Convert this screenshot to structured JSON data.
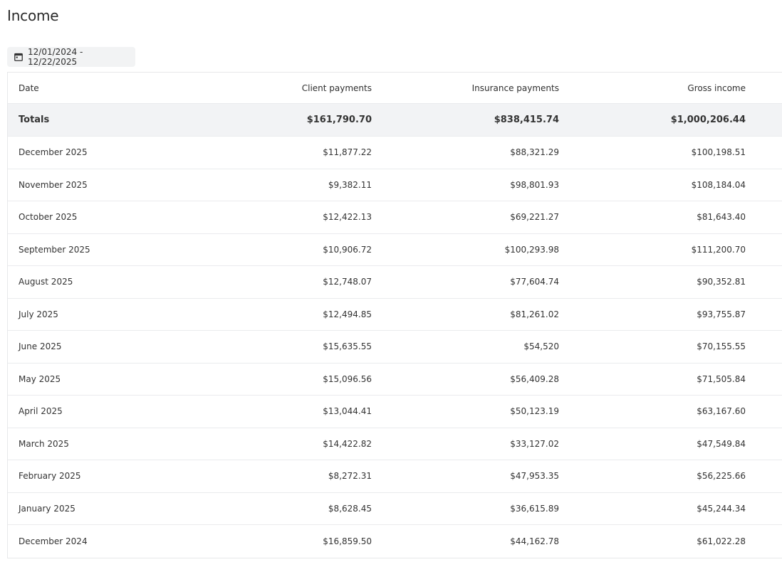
{
  "page": {
    "title": "Income"
  },
  "filter": {
    "date_range": "12/01/2024 - 12/22/2025",
    "icon": "calendar-icon"
  },
  "table": {
    "columns": {
      "date": "Date",
      "client": "Client payments",
      "insurance": "Insurance payments",
      "gross": "Gross income"
    },
    "totals": {
      "label": "Totals",
      "client": "$161,790.70",
      "insurance": "$838,415.74",
      "gross": "$1,000,206.44"
    },
    "rows": [
      {
        "date": "December 2025",
        "client": "$11,877.22",
        "insurance": "$88,321.29",
        "gross": "$100,198.51"
      },
      {
        "date": "November 2025",
        "client": "$9,382.11",
        "insurance": "$98,801.93",
        "gross": "$108,184.04"
      },
      {
        "date": "October 2025",
        "client": "$12,422.13",
        "insurance": "$69,221.27",
        "gross": "$81,643.40"
      },
      {
        "date": "September 2025",
        "client": "$10,906.72",
        "insurance": "$100,293.98",
        "gross": "$111,200.70"
      },
      {
        "date": "August 2025",
        "client": "$12,748.07",
        "insurance": "$77,604.74",
        "gross": "$90,352.81"
      },
      {
        "date": "July 2025",
        "client": "$12,494.85",
        "insurance": "$81,261.02",
        "gross": "$93,755.87"
      },
      {
        "date": "June 2025",
        "client": "$15,635.55",
        "insurance": "$54,520",
        "gross": "$70,155.55"
      },
      {
        "date": "May 2025",
        "client": "$15,096.56",
        "insurance": "$56,409.28",
        "gross": "$71,505.84"
      },
      {
        "date": "April 2025",
        "client": "$13,044.41",
        "insurance": "$50,123.19",
        "gross": "$63,167.60"
      },
      {
        "date": "March 2025",
        "client": "$14,422.82",
        "insurance": "$33,127.02",
        "gross": "$47,549.84"
      },
      {
        "date": "February 2025",
        "client": "$8,272.31",
        "insurance": "$47,953.35",
        "gross": "$56,225.66"
      },
      {
        "date": "January 2025",
        "client": "$8,628.45",
        "insurance": "$36,615.89",
        "gross": "$45,244.34"
      },
      {
        "date": "December 2024",
        "client": "$16,859.50",
        "insurance": "$44,162.78",
        "gross": "$61,022.28"
      }
    ]
  }
}
